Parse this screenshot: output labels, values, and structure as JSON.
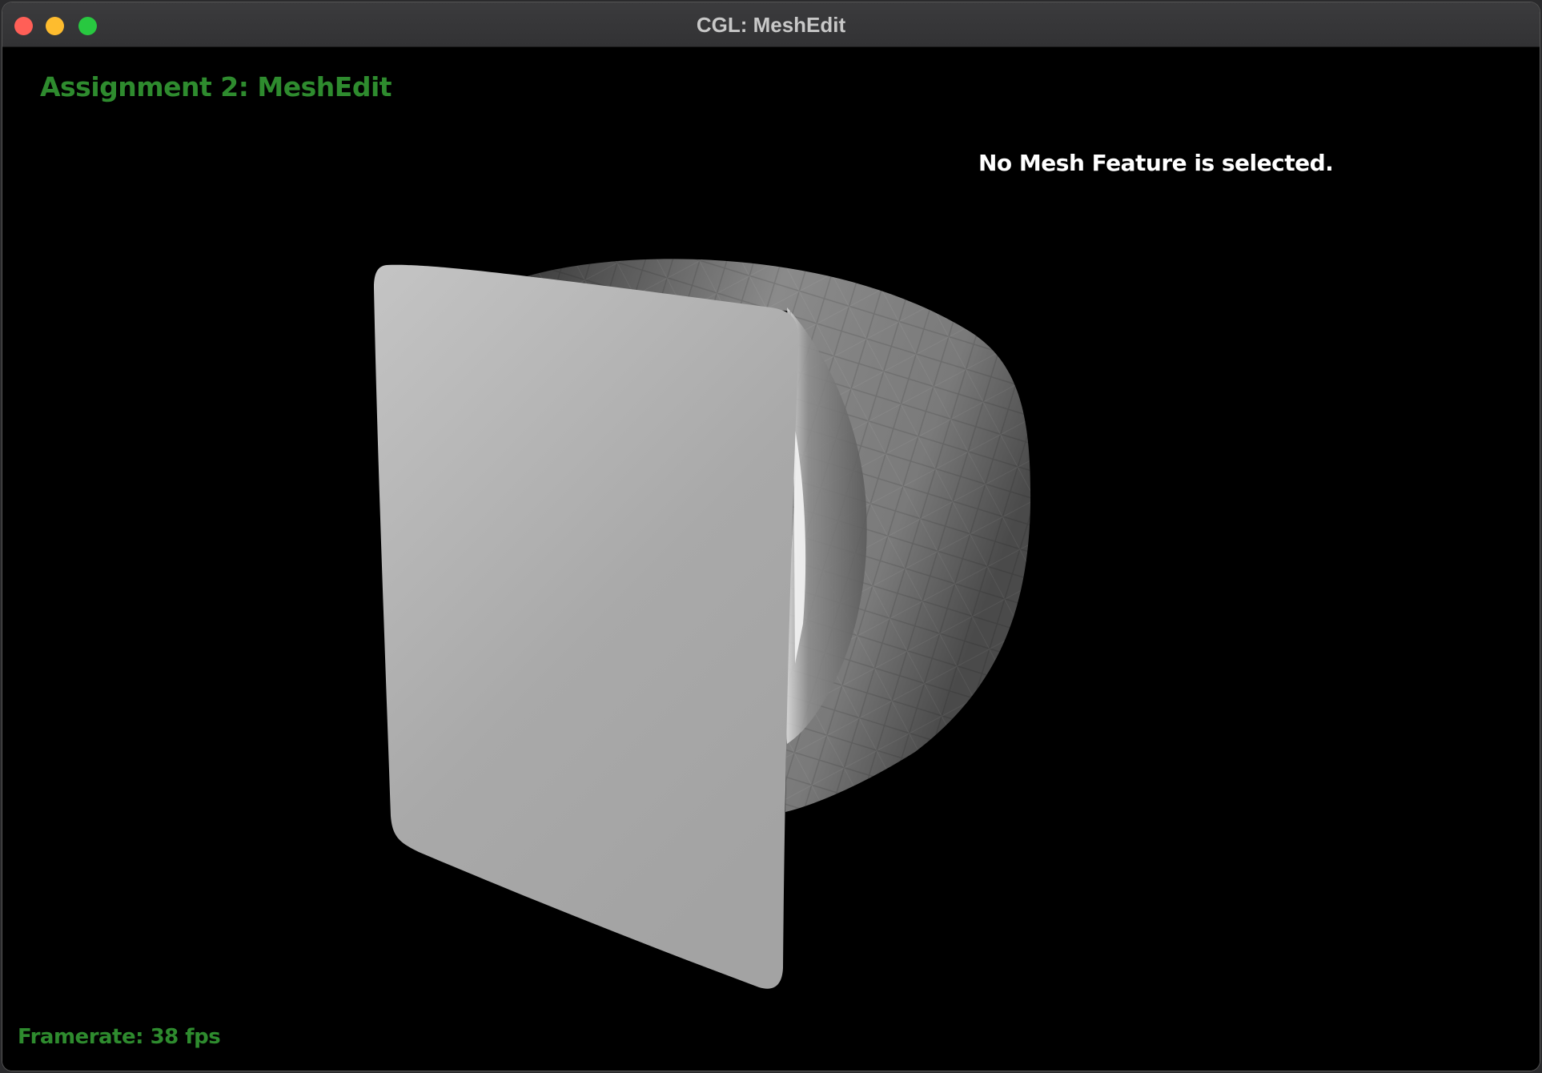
{
  "window": {
    "title": "CGL: MeshEdit"
  },
  "viewport": {
    "app_title": "Assignment 2: MeshEdit",
    "selection_status": "No Mesh Feature is selected.",
    "framerate": "Framerate: 38 fps"
  },
  "colors": {
    "background": "#000000",
    "accent_green": "#2e8b2e",
    "status_text": "#ffffff",
    "close_button": "#ff5f57",
    "minimize_button": "#febc2e",
    "zoom_button": "#28c840"
  },
  "icons": {
    "close": "close-icon",
    "minimize": "minimize-icon",
    "zoom": "zoom-icon"
  }
}
